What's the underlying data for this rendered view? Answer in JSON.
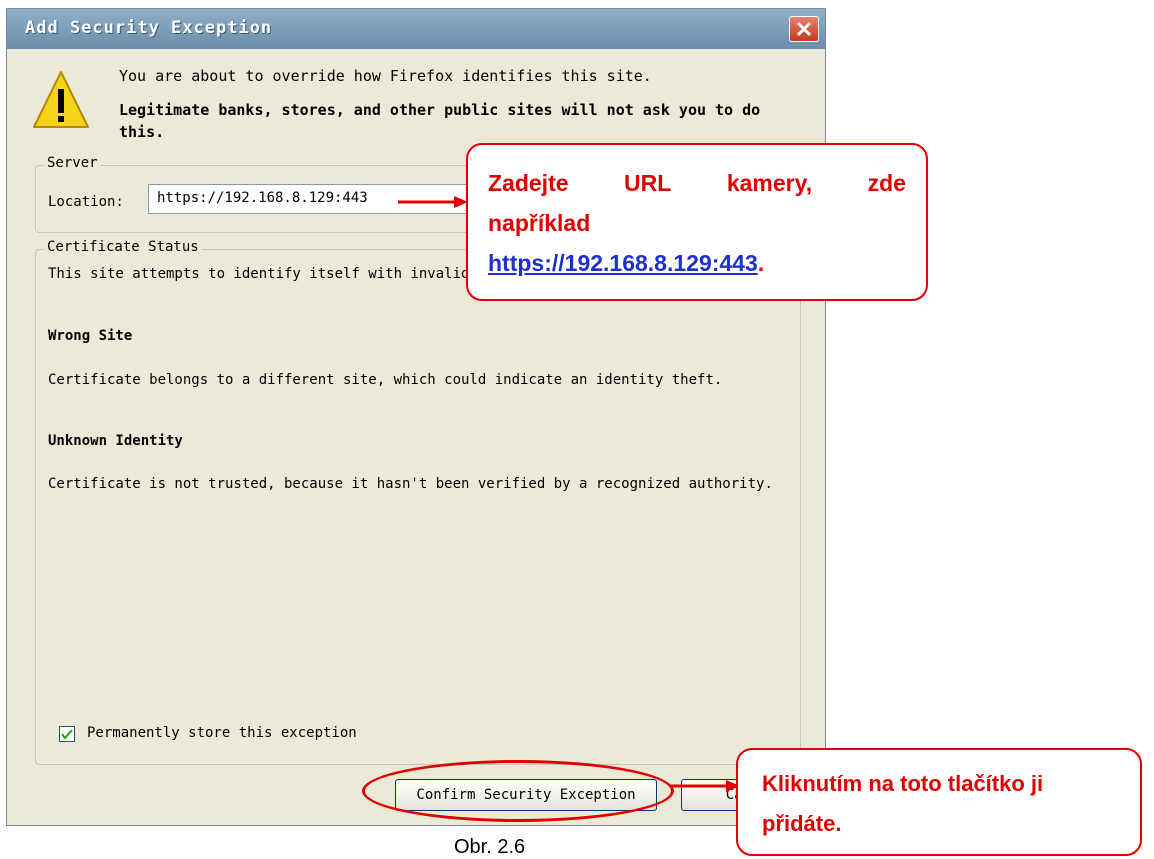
{
  "dialog": {
    "title": "Add Security Exception",
    "message_line1": "You are about to override how Firefox identifies this site.",
    "message_line2": "Legitimate banks, stores, and other public sites will not ask you to do this.",
    "server": {
      "group_label": "Server",
      "location_label": "Location:",
      "location_value": "https://192.168.8.129:443"
    },
    "status": {
      "group_label": "Certificate Status",
      "intro": "This site attempts to identify itself with invalid information.",
      "wrong_site_heading": "Wrong Site",
      "wrong_site_text": "Certificate belongs to a different site, which could indicate an identity theft.",
      "unknown_identity_heading": "Unknown Identity",
      "unknown_identity_text": "Certificate is not trusted, because it hasn't been verified by a recognized authority."
    },
    "permanent_checkbox": {
      "label": "Permanently store this exception",
      "checked": true
    },
    "confirm_button": "Confirm Security Exception",
    "cancel_button": "Cancel"
  },
  "annotations": {
    "callout_url": {
      "line1_words": [
        "Zadejte",
        "URL",
        "kamery,",
        "zde"
      ],
      "line2": "například",
      "link": "https://192.168.8.129:443",
      "trailing": "."
    },
    "callout_button": "Kliknutím na toto tlačítko ji přidáte."
  },
  "caption": "Obr. 2.6",
  "colors": {
    "annotation_red": "#e00000",
    "link_blue": "#1f2fd0",
    "dialog_bg": "#ece9d8"
  }
}
